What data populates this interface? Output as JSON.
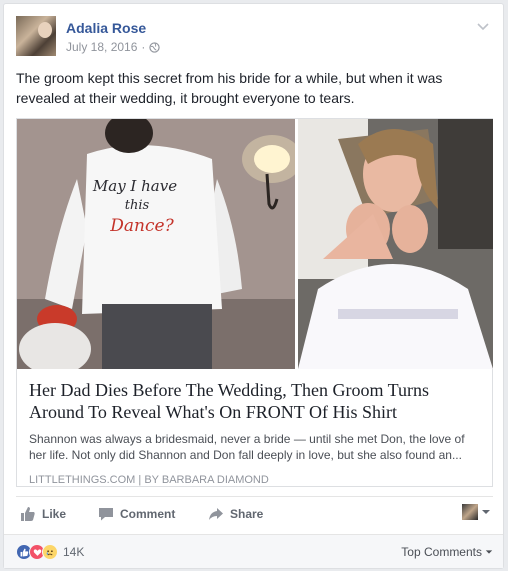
{
  "post": {
    "author": "Adalia Rose",
    "date": "July 18, 2016",
    "dot": "·",
    "caption": "The groom kept this secret from his bride for a while, but when it was revealed at their wedding, it brought everyone to tears."
  },
  "link": {
    "shirt_text": [
      "May I have",
      "this",
      "Dance?"
    ],
    "headline": "Her Dad Dies Before The Wedding, Then Groom Turns Around To Reveal What's On FRONT Of His Shirt",
    "description": "Shannon was always a bridesmaid, never a bride — until she met Don, the love of her life. Not only did Shannon and Don fall deeply in love, but she also found an...",
    "source": "LITTLETHINGS.COM",
    "separator": "|",
    "author": "BY BARBARA DIAMOND"
  },
  "actions": {
    "like": "Like",
    "comment": "Comment",
    "share": "Share"
  },
  "footer": {
    "reaction_count": "14K",
    "sort_label": "Top Comments"
  },
  "colors": {
    "link_blue": "#365899",
    "like_blue": "#4267b2",
    "love_red": "#f25268",
    "sad_yellow": "#fcd669"
  }
}
